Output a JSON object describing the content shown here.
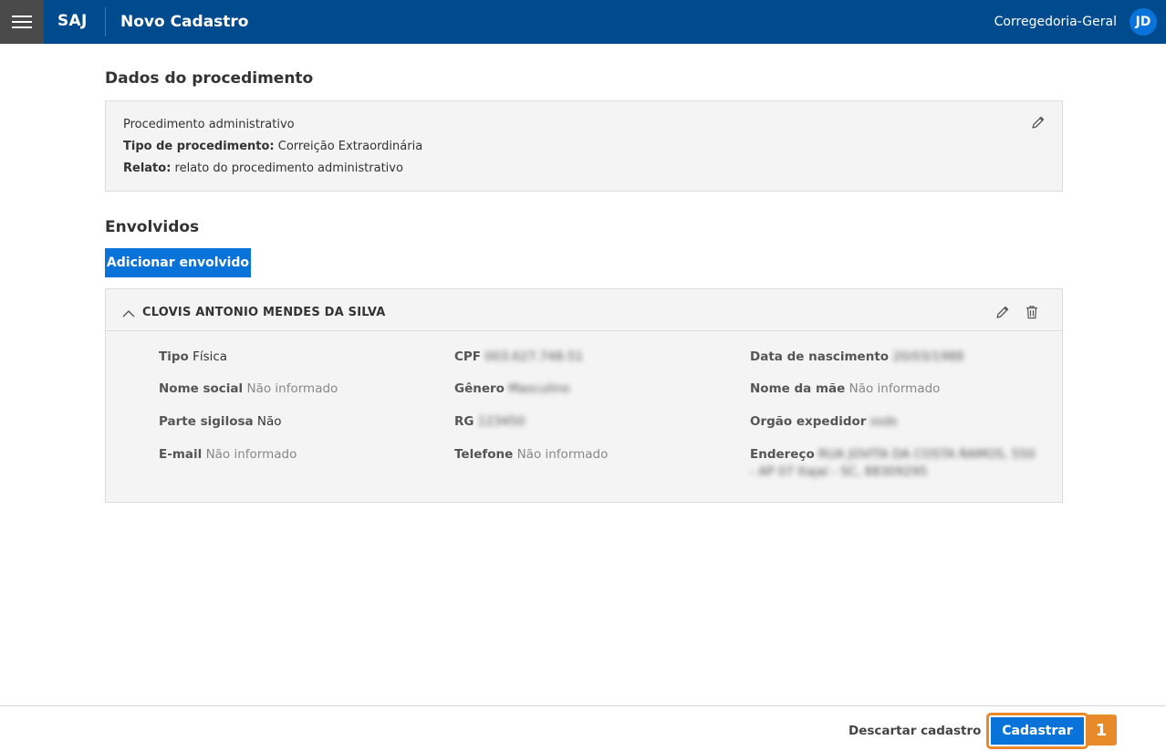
{
  "header": {
    "brand": "SAJ",
    "title": "Novo Cadastro",
    "org": "Corregedoria-Geral",
    "avatar_initials": "JD"
  },
  "procedure": {
    "section_title": "Dados do procedimento",
    "type_line": "Procedimento administrativo",
    "tipo_label": "Tipo de procedimento:",
    "tipo_value": "Correição Extraordinária",
    "relato_label": "Relato:",
    "relato_value": "relato do procedimento administrativo"
  },
  "involved": {
    "section_title": "Envolvidos",
    "add_button": "Adicionar envolvido",
    "person": {
      "name": "CLOVIS ANTONIO MENDES DA SILVA",
      "fields": {
        "tipo_label": "Tipo",
        "tipo_value": "Física",
        "cpf_label": "CPF",
        "cpf_value": "003.627.748-51",
        "nascimento_label": "Data de nascimento",
        "nascimento_value": "20/03/1988",
        "nome_social_label": "Nome social",
        "nome_social_value": "Não informado",
        "genero_label": "Gênero",
        "genero_value": "Masculino",
        "nome_mae_label": "Nome da mãe",
        "nome_mae_value": "Não informado",
        "sigilosa_label": "Parte sigilosa",
        "sigilosa_value": "Não",
        "rg_label": "RG",
        "rg_value": "123450",
        "orgao_label": "Orgão expedidor",
        "orgao_value": "ssds",
        "email_label": "E-mail",
        "email_value": "Não informado",
        "telefone_label": "Telefone",
        "telefone_value": "Não informado",
        "endereco_label": "Endereço",
        "endereco_value_1": "RUA JOVITA DA COSTA RAMOS, 550",
        "endereco_value_2": "- AP 07 Itajaí - SC, 88309295"
      }
    }
  },
  "footer": {
    "discard": "Descartar cadastro",
    "submit": "Cadastrar",
    "step": "1"
  },
  "colors": {
    "header_bg": "#004b8d",
    "primary": "#0a73d9",
    "highlight": "#e8892a"
  }
}
